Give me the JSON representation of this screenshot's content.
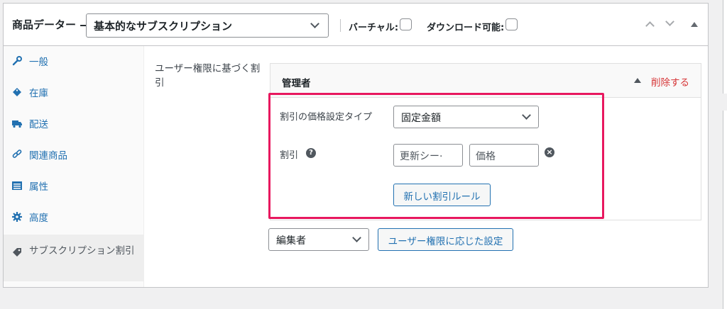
{
  "header": {
    "title": "商品データー —",
    "product_type": "基本的なサブスクリプション",
    "virtual_label": "バーチャル:",
    "downloadable_label": "ダウンロード可能:"
  },
  "tabs": [
    {
      "label": "一般",
      "icon": "wrench-icon"
    },
    {
      "label": "在庫",
      "icon": "tag-diamond-icon"
    },
    {
      "label": "配送",
      "icon": "truck-icon"
    },
    {
      "label": "関連商品",
      "icon": "link-icon"
    },
    {
      "label": "属性",
      "icon": "list-table-icon"
    },
    {
      "label": "高度",
      "icon": "gear-icon"
    },
    {
      "label": "サブスクリプション割引",
      "icon": "price-tag-icon",
      "active": true
    }
  ],
  "content": {
    "field_label": "ユーザー権限に基づく割引",
    "role": {
      "name": "管理者",
      "remove_label": "削除する",
      "pricing_type_label": "割引の価格設定タイプ",
      "pricing_type_value": "固定金額",
      "discount_label": "割引",
      "discount_help": "?",
      "renewal_placeholder": "更新シー·",
      "price_placeholder": "価格",
      "add_rule_label": "新しい割引ルール"
    },
    "role_select_value": "編集者",
    "role_settings_button": "ユーザー権限に応じた設定"
  },
  "colors": {
    "link": "#2271b1",
    "danger": "#d63638",
    "highlight": "#e8185f"
  }
}
